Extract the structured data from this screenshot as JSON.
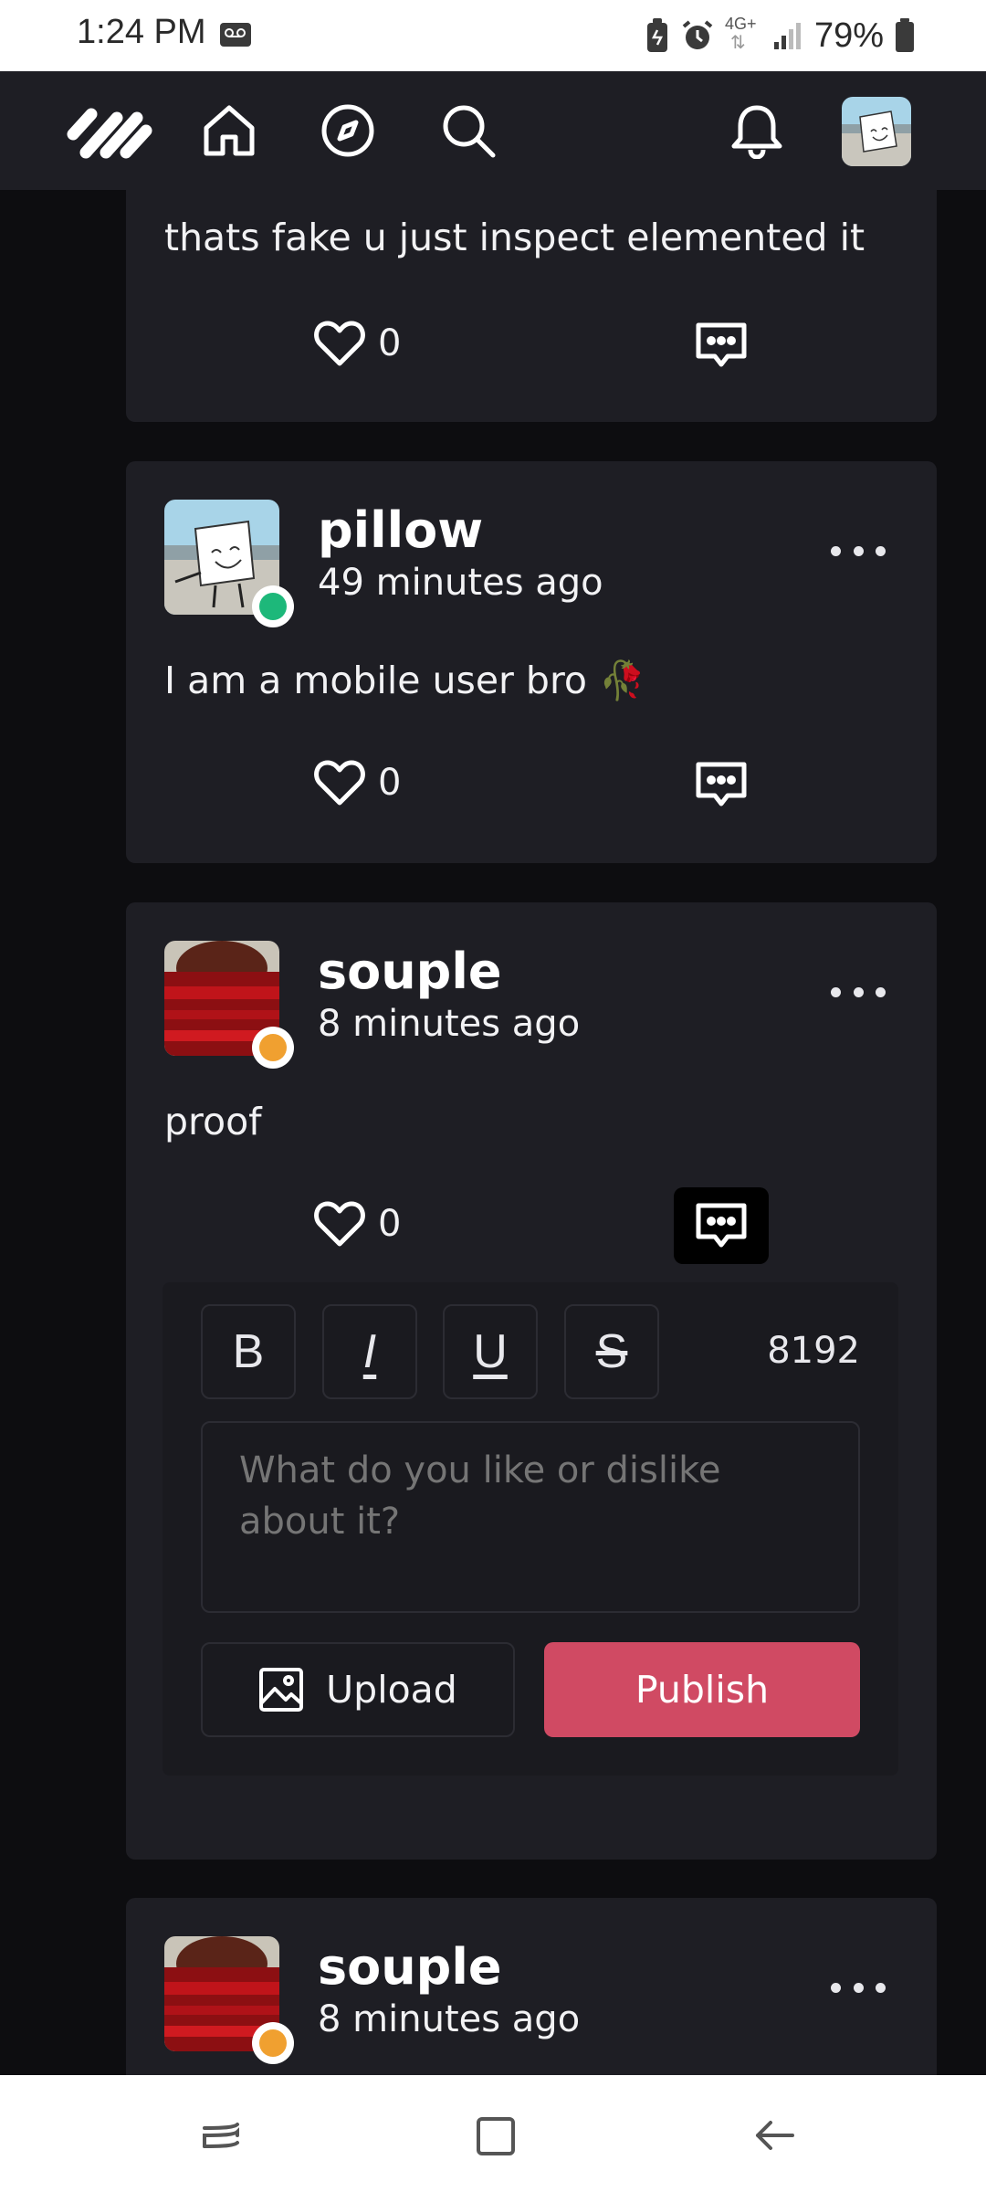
{
  "status_bar": {
    "time": "1:24 PM",
    "network": "4G+",
    "battery": "79%",
    "icons": [
      "voicemail-icon",
      "battery-saver-icon",
      "alarm-icon",
      "network-4g-icon",
      "signal-icon",
      "battery-icon"
    ]
  },
  "nav": {
    "icons": [
      "logo-icon",
      "home-icon",
      "compass-icon",
      "search-icon",
      "bell-icon",
      "user-avatar"
    ]
  },
  "feed": {
    "partial_post": {
      "text": "thats fake u just inspect elemented it",
      "likes": "0"
    },
    "posts": [
      {
        "username": "pillow",
        "time": "49 minutes ago",
        "text": "I am a mobile user bro 🥀",
        "likes": "0",
        "status_color": "#1db87a"
      },
      {
        "username": "souple",
        "time": "8 minutes ago",
        "text": "proof",
        "likes": "0",
        "status_color": "#f0a030"
      },
      {
        "username": "souple",
        "time": "8 minutes ago",
        "status_color": "#f0a030"
      }
    ]
  },
  "editor": {
    "bold": "B",
    "italic": "I",
    "underline": "U",
    "strikethrough": "S",
    "char_count": "8192",
    "placeholder": "What do you like or dislike about it?",
    "upload_label": "Upload",
    "publish_label": "Publish"
  },
  "colors": {
    "background": "#0d0d10",
    "card": "#1e1e24",
    "accent": "#d04a63",
    "online": "#1db87a",
    "away": "#f0a030"
  }
}
